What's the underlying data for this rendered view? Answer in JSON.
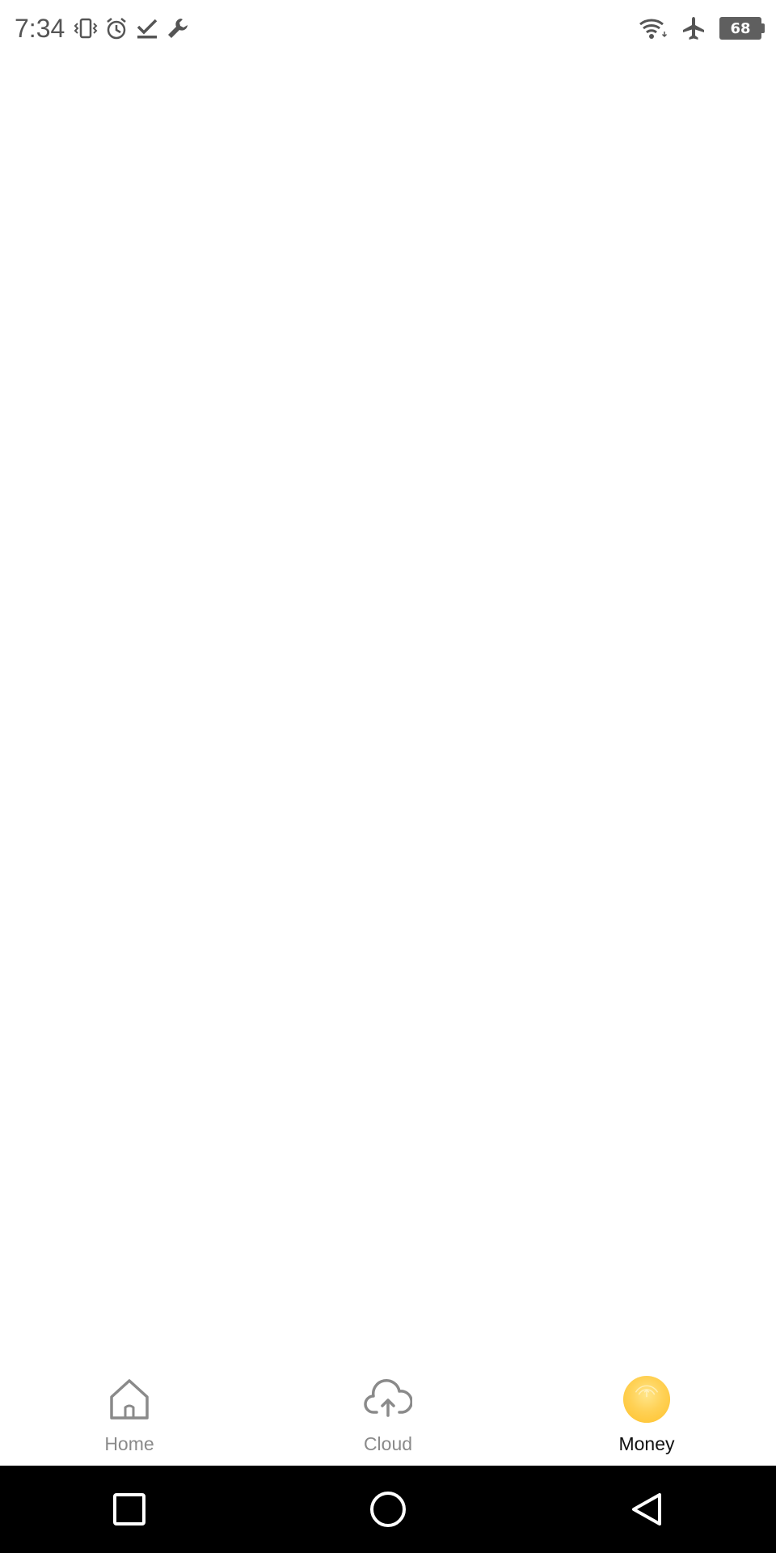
{
  "status_bar": {
    "time": "7:34",
    "battery_level": "68",
    "left_icons": [
      "vibrate-icon",
      "alarm-icon",
      "check-icon",
      "wrench-icon"
    ],
    "right_icons": [
      "wifi-icon",
      "airplane-icon",
      "battery-icon"
    ]
  },
  "tabs": [
    {
      "label": "Home",
      "icon": "home-icon",
      "active": false
    },
    {
      "label": "Cloud",
      "icon": "cloud-upload-icon",
      "active": false
    },
    {
      "label": "Money",
      "icon": "coin-icon",
      "active": true
    }
  ],
  "nav_bar": {
    "buttons": [
      "recents-button",
      "home-button",
      "back-button"
    ]
  },
  "colors": {
    "accent": "#FFC83D",
    "inactive": "#8a8a8a",
    "active_text": "#111111"
  }
}
